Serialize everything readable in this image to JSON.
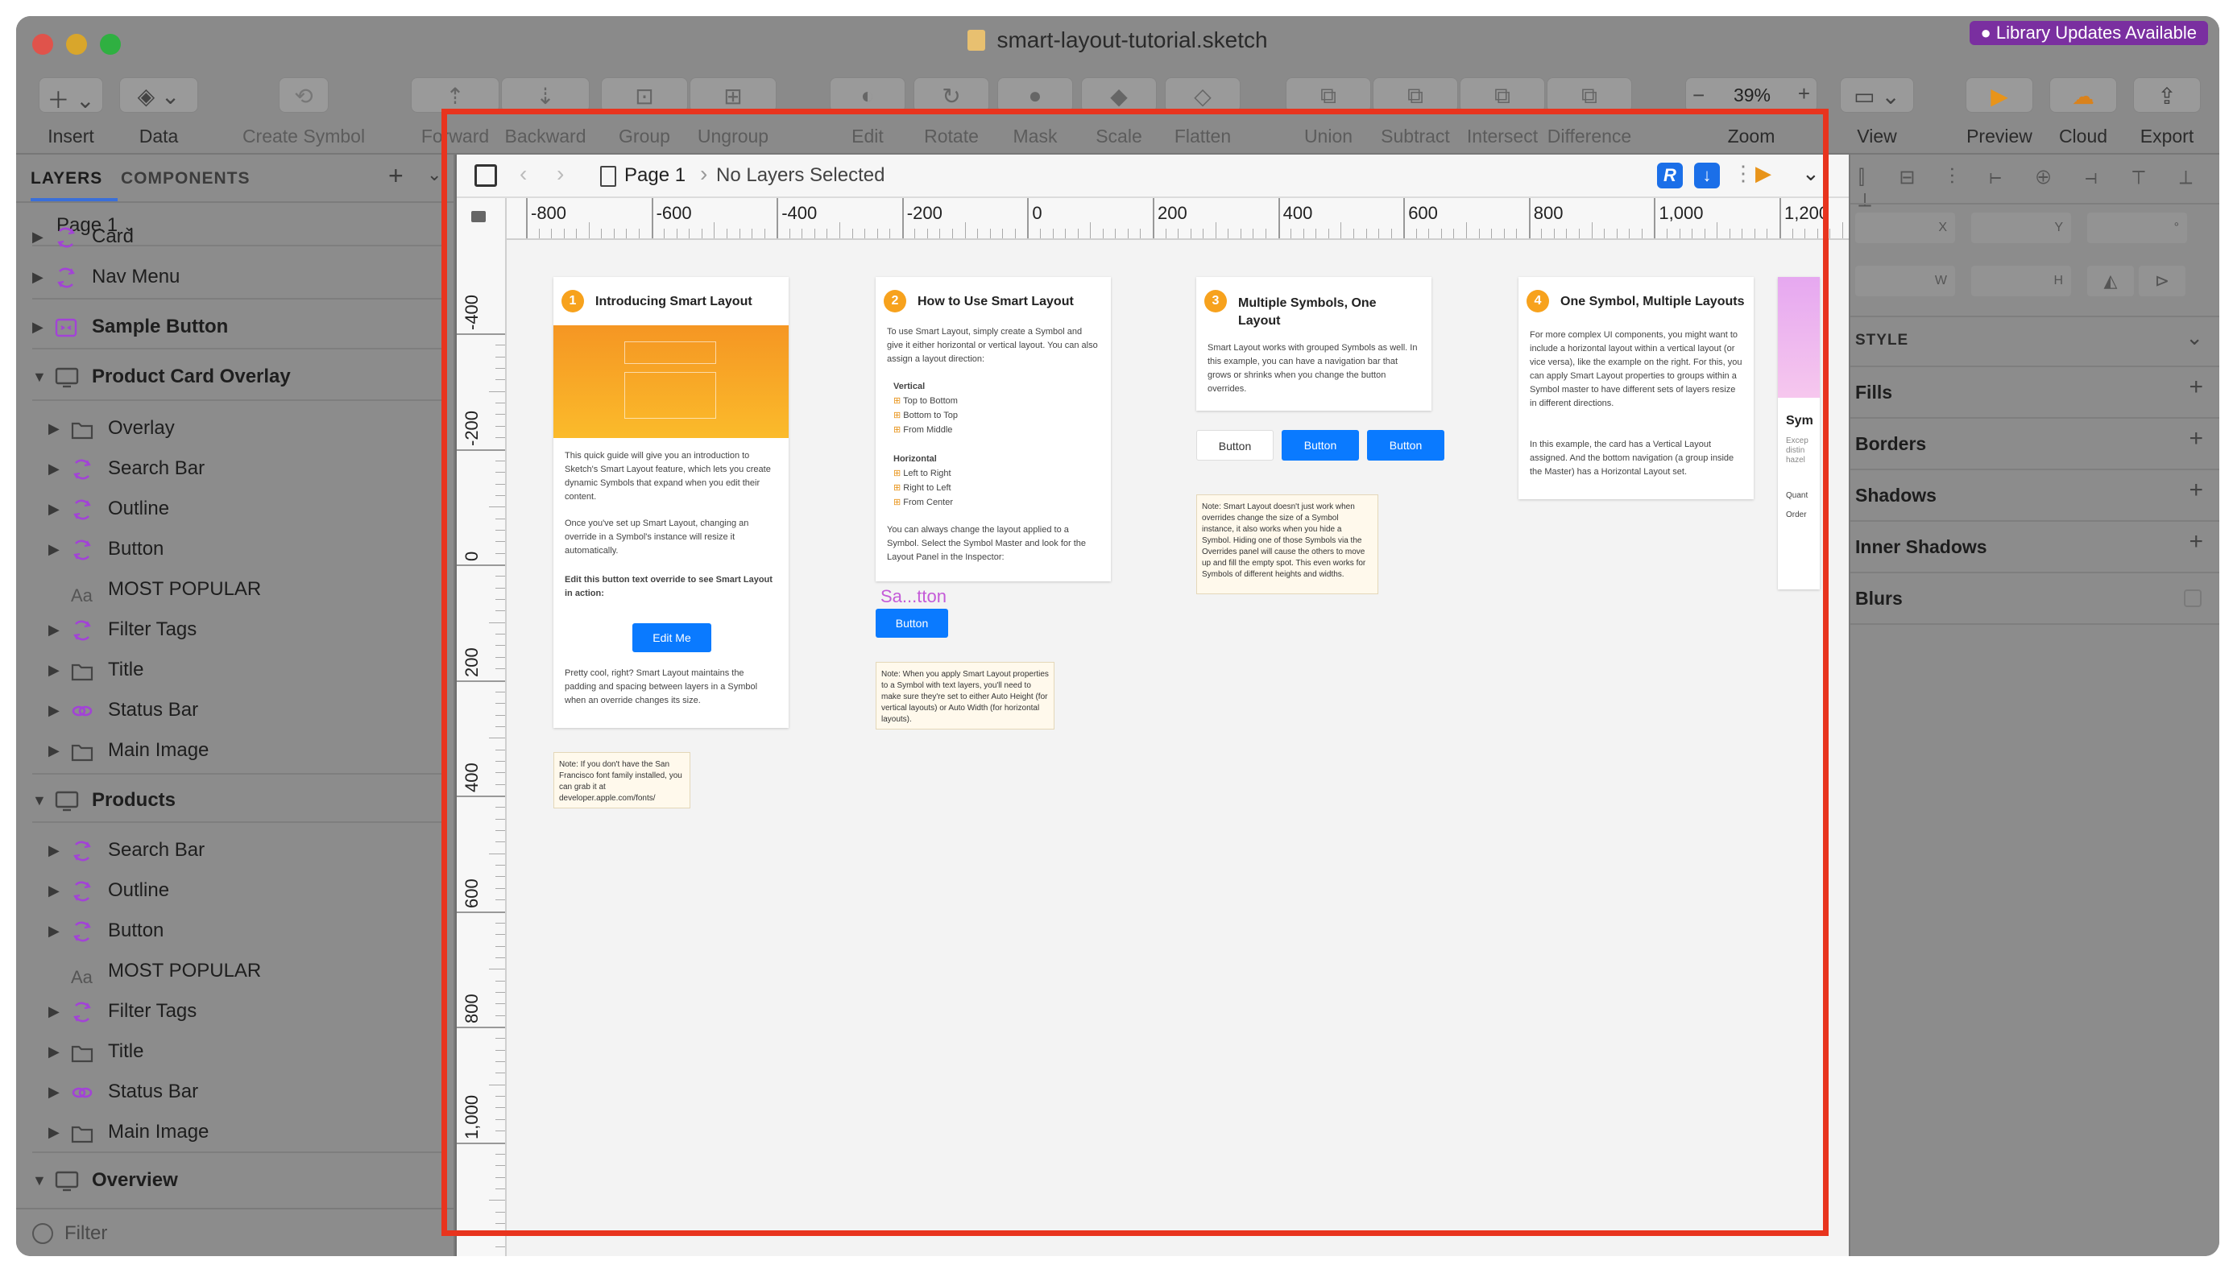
{
  "window": {
    "title": "smart-layout-tutorial.sketch",
    "library_badge": "● Library Updates Available",
    "traffic_colors": {
      "close": "#fe5f57",
      "minimize": "#febc2e",
      "zoom": "#28c840"
    }
  },
  "toolbar": {
    "insert": "Insert",
    "data": "Data",
    "create_symbol": "Create Symbol",
    "forward": "Forward",
    "backward": "Backward",
    "group": "Group",
    "ungroup": "Ungroup",
    "edit": "Edit",
    "rotate": "Rotate",
    "mask": "Mask",
    "scale": "Scale",
    "flatten": "Flatten",
    "union": "Union",
    "subtract": "Subtract",
    "intersect": "Intersect",
    "difference": "Difference",
    "zoom_label": "Zoom",
    "zoom_value": "39%",
    "view": "View",
    "preview": "Preview",
    "cloud": "Cloud",
    "export": "Export"
  },
  "layers_panel": {
    "tab_layers": "LAYERS",
    "tab_components": "COMPONENTS",
    "page": "Page 1",
    "filter_placeholder": "Filter",
    "items": [
      {
        "label": "Card",
        "icon": "symbol-icon",
        "depth": 0,
        "bold": false
      },
      {
        "label": "Nav Menu",
        "icon": "symbol-icon",
        "depth": 0,
        "bold": false
      },
      {
        "label": "Sample Button",
        "icon": "symbol-master-icon",
        "depth": 0,
        "bold": true
      },
      {
        "label": "Product Card Overlay",
        "icon": "artboard-icon",
        "depth": 0,
        "bold": true
      },
      {
        "label": "Overlay",
        "icon": "folder-icon",
        "depth": 1,
        "bold": false
      },
      {
        "label": "Search Bar",
        "icon": "symbol-icon",
        "depth": 1,
        "bold": false
      },
      {
        "label": "Outline",
        "icon": "symbol-icon",
        "depth": 1,
        "bold": false
      },
      {
        "label": "Button",
        "icon": "symbol-icon",
        "depth": 1,
        "bold": false
      },
      {
        "label": "MOST POPULAR",
        "icon": "text-icon",
        "depth": 1,
        "bold": false
      },
      {
        "label": "Filter Tags",
        "icon": "symbol-icon",
        "depth": 1,
        "bold": false
      },
      {
        "label": "Title",
        "icon": "folder-icon",
        "depth": 1,
        "bold": false
      },
      {
        "label": "Status Bar",
        "icon": "linked-symbol-icon",
        "depth": 1,
        "bold": false
      },
      {
        "label": "Main Image",
        "icon": "folder-icon",
        "depth": 1,
        "bold": false
      },
      {
        "label": "Products",
        "icon": "artboard-icon",
        "depth": 0,
        "bold": true
      },
      {
        "label": "Search Bar",
        "icon": "symbol-icon",
        "depth": 1,
        "bold": false
      },
      {
        "label": "Outline",
        "icon": "symbol-icon",
        "depth": 1,
        "bold": false
      },
      {
        "label": "Button",
        "icon": "symbol-icon",
        "depth": 1,
        "bold": false
      },
      {
        "label": "MOST POPULAR",
        "icon": "text-icon",
        "depth": 1,
        "bold": false
      },
      {
        "label": "Filter Tags",
        "icon": "symbol-icon",
        "depth": 1,
        "bold": false
      },
      {
        "label": "Title",
        "icon": "folder-icon",
        "depth": 1,
        "bold": false
      },
      {
        "label": "Status Bar",
        "icon": "linked-symbol-icon",
        "depth": 1,
        "bold": false
      },
      {
        "label": "Main Image",
        "icon": "folder-icon",
        "depth": 1,
        "bold": false
      },
      {
        "label": "Overview",
        "icon": "artboard-icon",
        "depth": 0,
        "bold": true
      }
    ]
  },
  "canvas": {
    "breadcrumb_page": "Page 1",
    "breadcrumb_selection": "No Layers Selected",
    "ruler_top": [
      "-800",
      "-600",
      "-400",
      "-200",
      "0",
      "200",
      "400",
      "600",
      "800",
      "1,000",
      "1,200"
    ],
    "ruler_left": [
      "-400",
      "-200",
      "0",
      "200",
      "400",
      "600",
      "800",
      "1,000"
    ],
    "boards": [
      {
        "num": "1",
        "title": "Introducing Smart Layout",
        "p1": "This quick guide will give you an introduction to Sketch's Smart Layout feature, which lets you create dynamic Symbols that expand when you edit their content.",
        "p2": "Once you've set up Smart Layout, changing an override in a Symbol's instance will resize it automatically.",
        "p3": "Edit this button text override to see Smart Layout in action:",
        "button": "Edit Me",
        "p4": "Pretty cool, right? Smart Layout maintains the padding and spacing between layers in a Symbol when an override changes its size.",
        "note": "Note: If you don't have the San Francisco font family installed, you can grab it at developer.apple.com/fonts/"
      },
      {
        "num": "2",
        "title": "How to Use Smart Layout",
        "p1": "To use Smart Layout, simply create a Symbol and give it either horizontal or vertical layout. You can also assign a layout direction:",
        "vertical": "Vertical",
        "v_items": [
          "Top to Bottom",
          "Bottom to Top",
          "From Middle"
        ],
        "horizontal": "Horizontal",
        "h_items": [
          "Left to Right",
          "Right to Left",
          "From Center"
        ],
        "p2": "You can always change the layout applied to a Symbol. Select the Symbol Master and look for the Layout Panel in the Inspector:",
        "sample_label": "Sa...tton",
        "button": "Button",
        "note": "Note: When you apply Smart Layout properties to a Symbol with text layers, you'll need to make sure they're set to either Auto Height (for vertical layouts) or Auto Width (for horizontal layouts)."
      },
      {
        "num": "3",
        "title": "Multiple Symbols, One Layout",
        "p1": "Smart Layout works with grouped Symbols as well. In this example, you can have a navigation bar that grows or shrinks when you change the button overrides.",
        "buttons": [
          "Button",
          "Button",
          "Button"
        ],
        "note": "Note: Smart Layout doesn't just work when overrides change the size of a Symbol instance, it also works when you hide a Symbol. Hiding one of those Symbols via the Overrides panel will cause the others to move up and fill the empty spot. This even works for Symbols of different heights and widths."
      },
      {
        "num": "4",
        "title": "One Symbol, Multiple Layouts",
        "p1": "For more complex UI components, you might want to include a horizontal layout within a vertical layout (or vice versa), like the example on the right. For this, you can apply Smart Layout properties to groups within a Symbol master to have different sets of layers resize in different directions.",
        "p2": "In this example, the card has a Vertical Layout assigned. And the bottom navigation (a group inside the Master) has a Horizontal Layout set."
      }
    ],
    "partial_card": {
      "title": "Sym",
      "lines": [
        "Excep",
        "distin",
        "hazel"
      ],
      "quant": "Quant",
      "order": "Order"
    }
  },
  "inspector": {
    "x": "X",
    "y": "Y",
    "w": "W",
    "h": "H",
    "deg": "°",
    "style": "STYLE",
    "fills": "Fills",
    "borders": "Borders",
    "shadows": "Shadows",
    "inner_shadows": "Inner Shadows",
    "blurs": "Blurs"
  },
  "colors": {
    "accent": "#0a7aff",
    "badge": "#f7a21d",
    "frame": "#e8341e",
    "library": "#7a2fa0",
    "symbol_purple": "#a243d6"
  }
}
